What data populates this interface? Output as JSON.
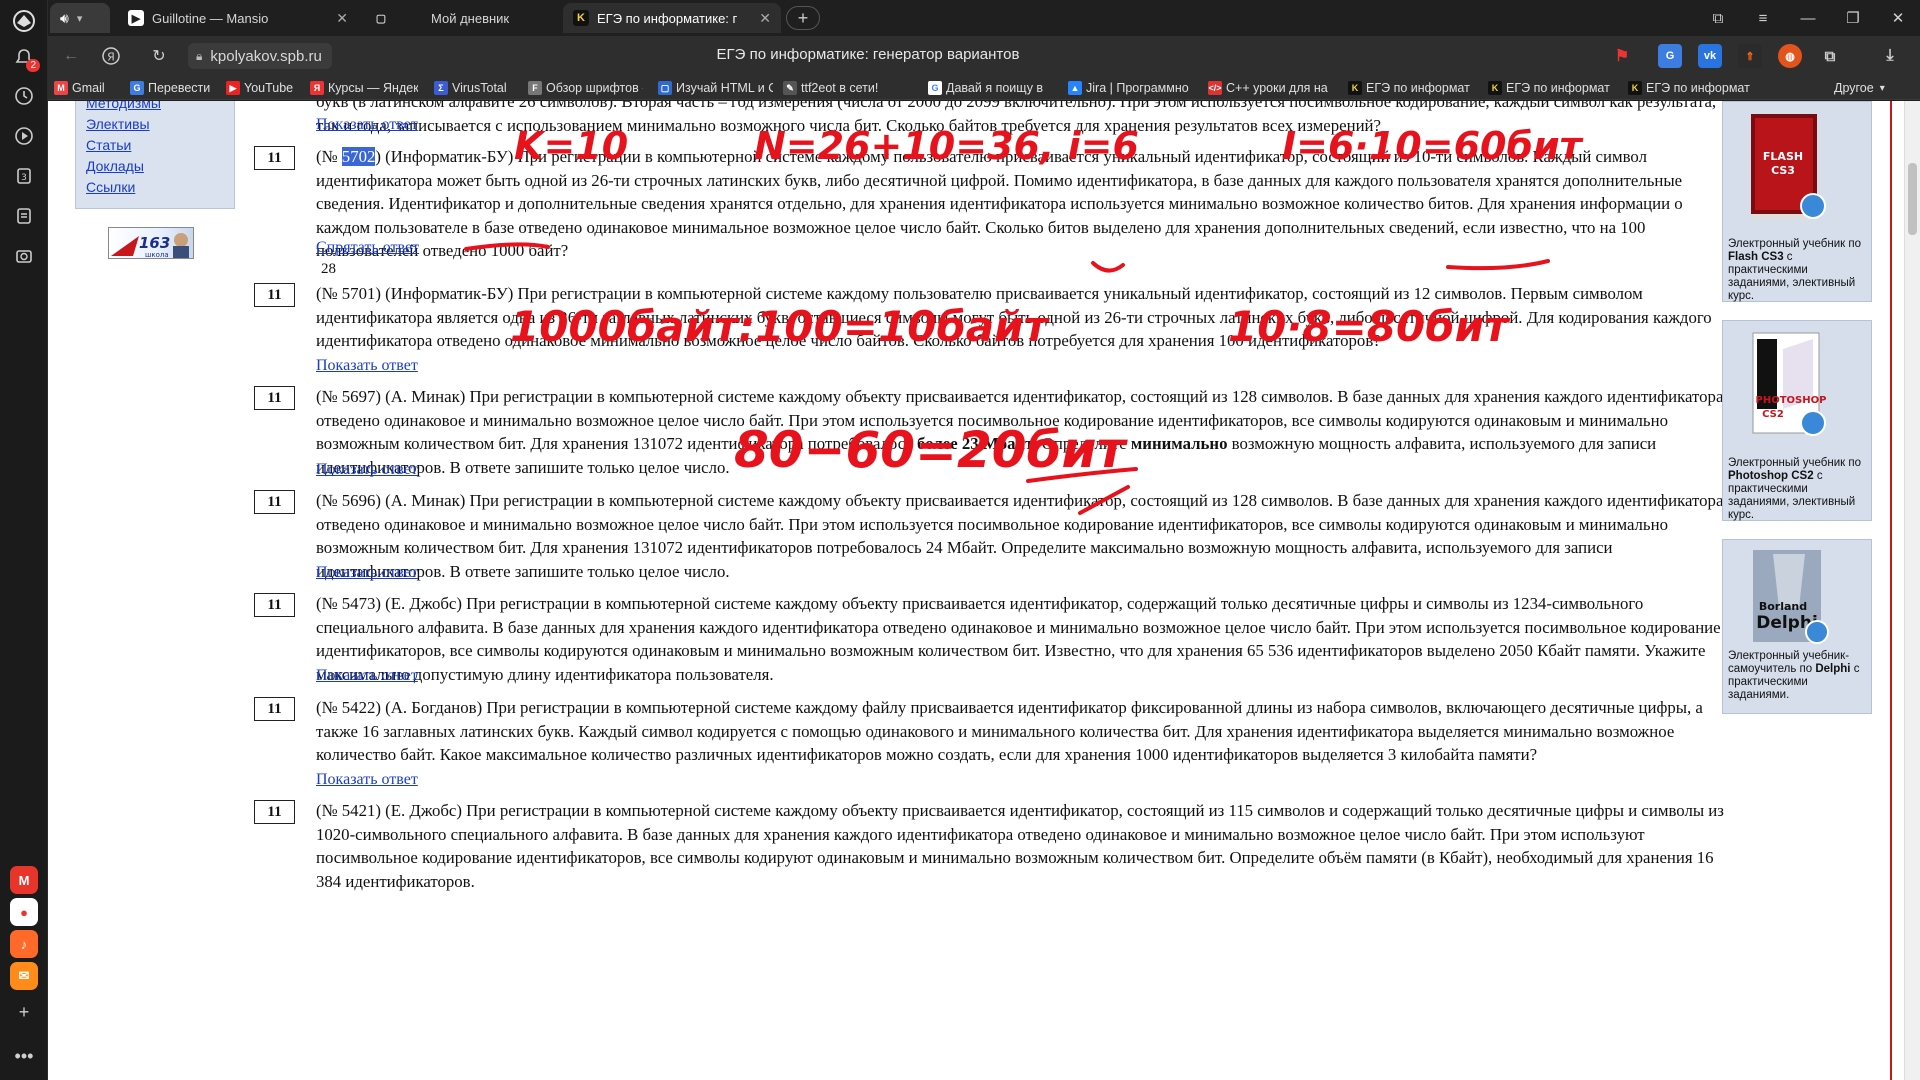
{
  "rail": {
    "notifications": "2"
  },
  "tabs": [
    {
      "title": "Guillotine — Mansio"
    },
    {
      "title": "Мой дневник"
    },
    {
      "title": "ЕГЭ по информатике: г"
    }
  ],
  "toolbar": {
    "url": "kpolyakov.spb.ru",
    "page_title": "ЕГЭ по информатике: генератор вариантов"
  },
  "bookmarks": [
    "Gmail",
    "Перевести",
    "YouTube",
    "Курсы — Яндекс.",
    "VirusTotal",
    "Обзор шрифтов -",
    "Изучай HTML и С",
    "ttf2eot в сети!",
    "Давай я поищу в",
    "Jira | Программно",
    "C++ уроки для на",
    "ЕГЭ по информат",
    "ЕГЭ по информат",
    "ЕГЭ по информат"
  ],
  "bookmarks_other": "Другое",
  "leftmenu": [
    "Методизмы",
    "Элективы",
    "Статьи",
    "Доклады",
    "Ссылки"
  ],
  "show_answer": "Показать ответ",
  "hide_answer": "Спрятать ответ",
  "questions": [
    {
      "tail": "букв (в латинском алфавите 26 символов). Вторая часть – год измерения (числа от 2000 до 2099 включительно). При этом используется посимвольное кодирование, каждый символ как результата, так и года, записывается с использованием минимально возможного числа бит. Сколько байтов требуется для хранения результатов всех измерений?"
    },
    {
      "num": "11",
      "pre": "(№ ",
      "id": "5702",
      "text": ") (Информатик-БУ) При регистрации в компьютерной системе каждому пользователю присваивается уникальный идентификатор, состоящий из 10-ти символов. Каждый символ идентификатора может быть одной из 26-ти строчных латинских букв, либо десятичной цифрой. Помимо идентификатора, в базе данных для каждого пользователя хранятся дополнительные сведения. Идентификатор и дополнительные сведения хранятся отдельно, для хранения идентификатора используется минимально возможное количество битов. Для хранения информации о каждом пользователе в базе отведено одинаковое минимальное возможное целое число байт. Сколько битов выделено для хранения дополнительных сведений, если известно, что на 100 пользователей отведено 1000 байт?",
      "answer": "28"
    },
    {
      "num": "11",
      "text": "(№ 5701) (Информатик-БУ) При регистрации в компьютерной системе каждому пользователю присваивается уникальный идентификатор, состоящий из 12 символов. Первым символом идентификатора является одна из 26-ти заглавных латинских букв, оставшиеся символы могут быть одной из 26-ти строчных латинских букв, либо десятичной цифрой. Для кодирования каждого идентификатора отведено одинаковое минимально возможное целое число байтов. Сколько байтов потребуется для хранения 100 идентификаторов?"
    },
    {
      "num": "11",
      "a": "(№ 5697) (А. Минак) При регистрации в компьютерной системе каждому объекту присваивается идентификатор, состоящий из 128 символов. В базе данных для хранения каждого идентификатора отведено одинаковое и минимально возможное целое число байт. При этом используется посимвольное кодирование идентификаторов, все символы кодируются одинаковым и минимально возможным количеством бит. Для хранения 131072 идентификатора потребовалось ",
      "b1": "более 23 Мбайт",
      "c": ". Определите ",
      "b2": "минимально",
      "d": " возможную мощность алфавита, используемого для записи идентификаторов. В ответе запишите только целое число."
    },
    {
      "num": "11",
      "text": "(№ 5696) (А. Минак) При регистрации в компьютерной системе каждому объекту присваивается идентификатор, состоящий из 128 символов. В базе данных для хранения каждого идентификатора отведено одинаковое и минимально возможное целое число байт. При этом используется посимвольное кодирование идентификаторов, все символы кодируются одинаковым и минимально возможным количеством бит. Для хранения 131072 идентификаторов потребовалось 24 Мбайт. Определите максимально возможную мощность алфавита, используемого для записи идентификаторов. В ответе запишите только целое число."
    },
    {
      "num": "11",
      "text": "(№ 5473) (Е. Джобс) При регистрации в компьютерной системе каждому объекту присваивается идентификатор, содержащий только десятичные цифры и символы из 1234-символьного специального алфавита. В базе данных для хранения каждого идентификатора отведено одинаковое и минимально возможное целое число байт. При этом используется посимвольное кодирование идентификаторов, все символы кодируются одинаковым и минимально возможным количеством бит. Известно, что для хранения 65 536 идентификаторов выделено 2050 Кбайт памяти. Укажите максимально допустимую длину идентификатора пользователя."
    },
    {
      "num": "11",
      "text": "(№ 5422) (А. Богданов) При регистрации в компьютерной системе каждому файлу присваивается идентификатор фиксированной длины из набора символов, включающего десятичные цифры, а также 16 заглавных латинских букв. Каждый символ кодируется с помощью одинакового и минимального количества бит. Для хранения идентификатора выделяется минимально возможное количество байт. Какое максимальное количество различных идентификаторов можно создать, если для хранения 1000 идентификаторов выделяется 3 килобайта памяти?"
    },
    {
      "num": "11",
      "text": "(№ 5421) (Е. Джобс) При регистрации в компьютерной системе каждому объекту присваивается идентификатор, состоящий из 115 символов и содержащий только десятичные цифры и символы из 1020-символьного специального алфавита. В базе данных для хранения каждого идентификатора отведено одинаковое и минимально возможное целое число байт. При этом используют посимвольное кодирование идентификаторов, все символы кодируют одинаковым и минимально возможным количеством бит. Определите объём памяти (в Кбайт), необходимый для хранения 16 384 идентификаторов."
    }
  ],
  "books": [
    {
      "cover1": "FLASH",
      "cover2": "CS3",
      "d1": "Электронный учебник по ",
      "b": "Flash CS3",
      "d2": " с практическими заданиями, элективный курс."
    },
    {
      "cover1": "PHOTOSHOP",
      "cover2": "CS2",
      "d1": "Электронный учебник по ",
      "b": "Photoshop CS2",
      "d2": " с практическими заданиями, элективный курс."
    },
    {
      "cover1": "Borland",
      "cover2": "Delphi",
      "d1": "Электронный учебник-самоучитель по ",
      "b": "Delphi",
      "d2": " с практическими заданиями."
    }
  ],
  "ink": [
    "K=10",
    "N=26+10=36, i=6",
    "I=6·10=60бит",
    "1000байт:100=10байт",
    "10·8=80бит",
    "80−60=20бит"
  ],
  "colors": {
    "accent_red": "#e8121c",
    "link_blue": "#1a3ccc",
    "highlight": "#3a66d8"
  }
}
